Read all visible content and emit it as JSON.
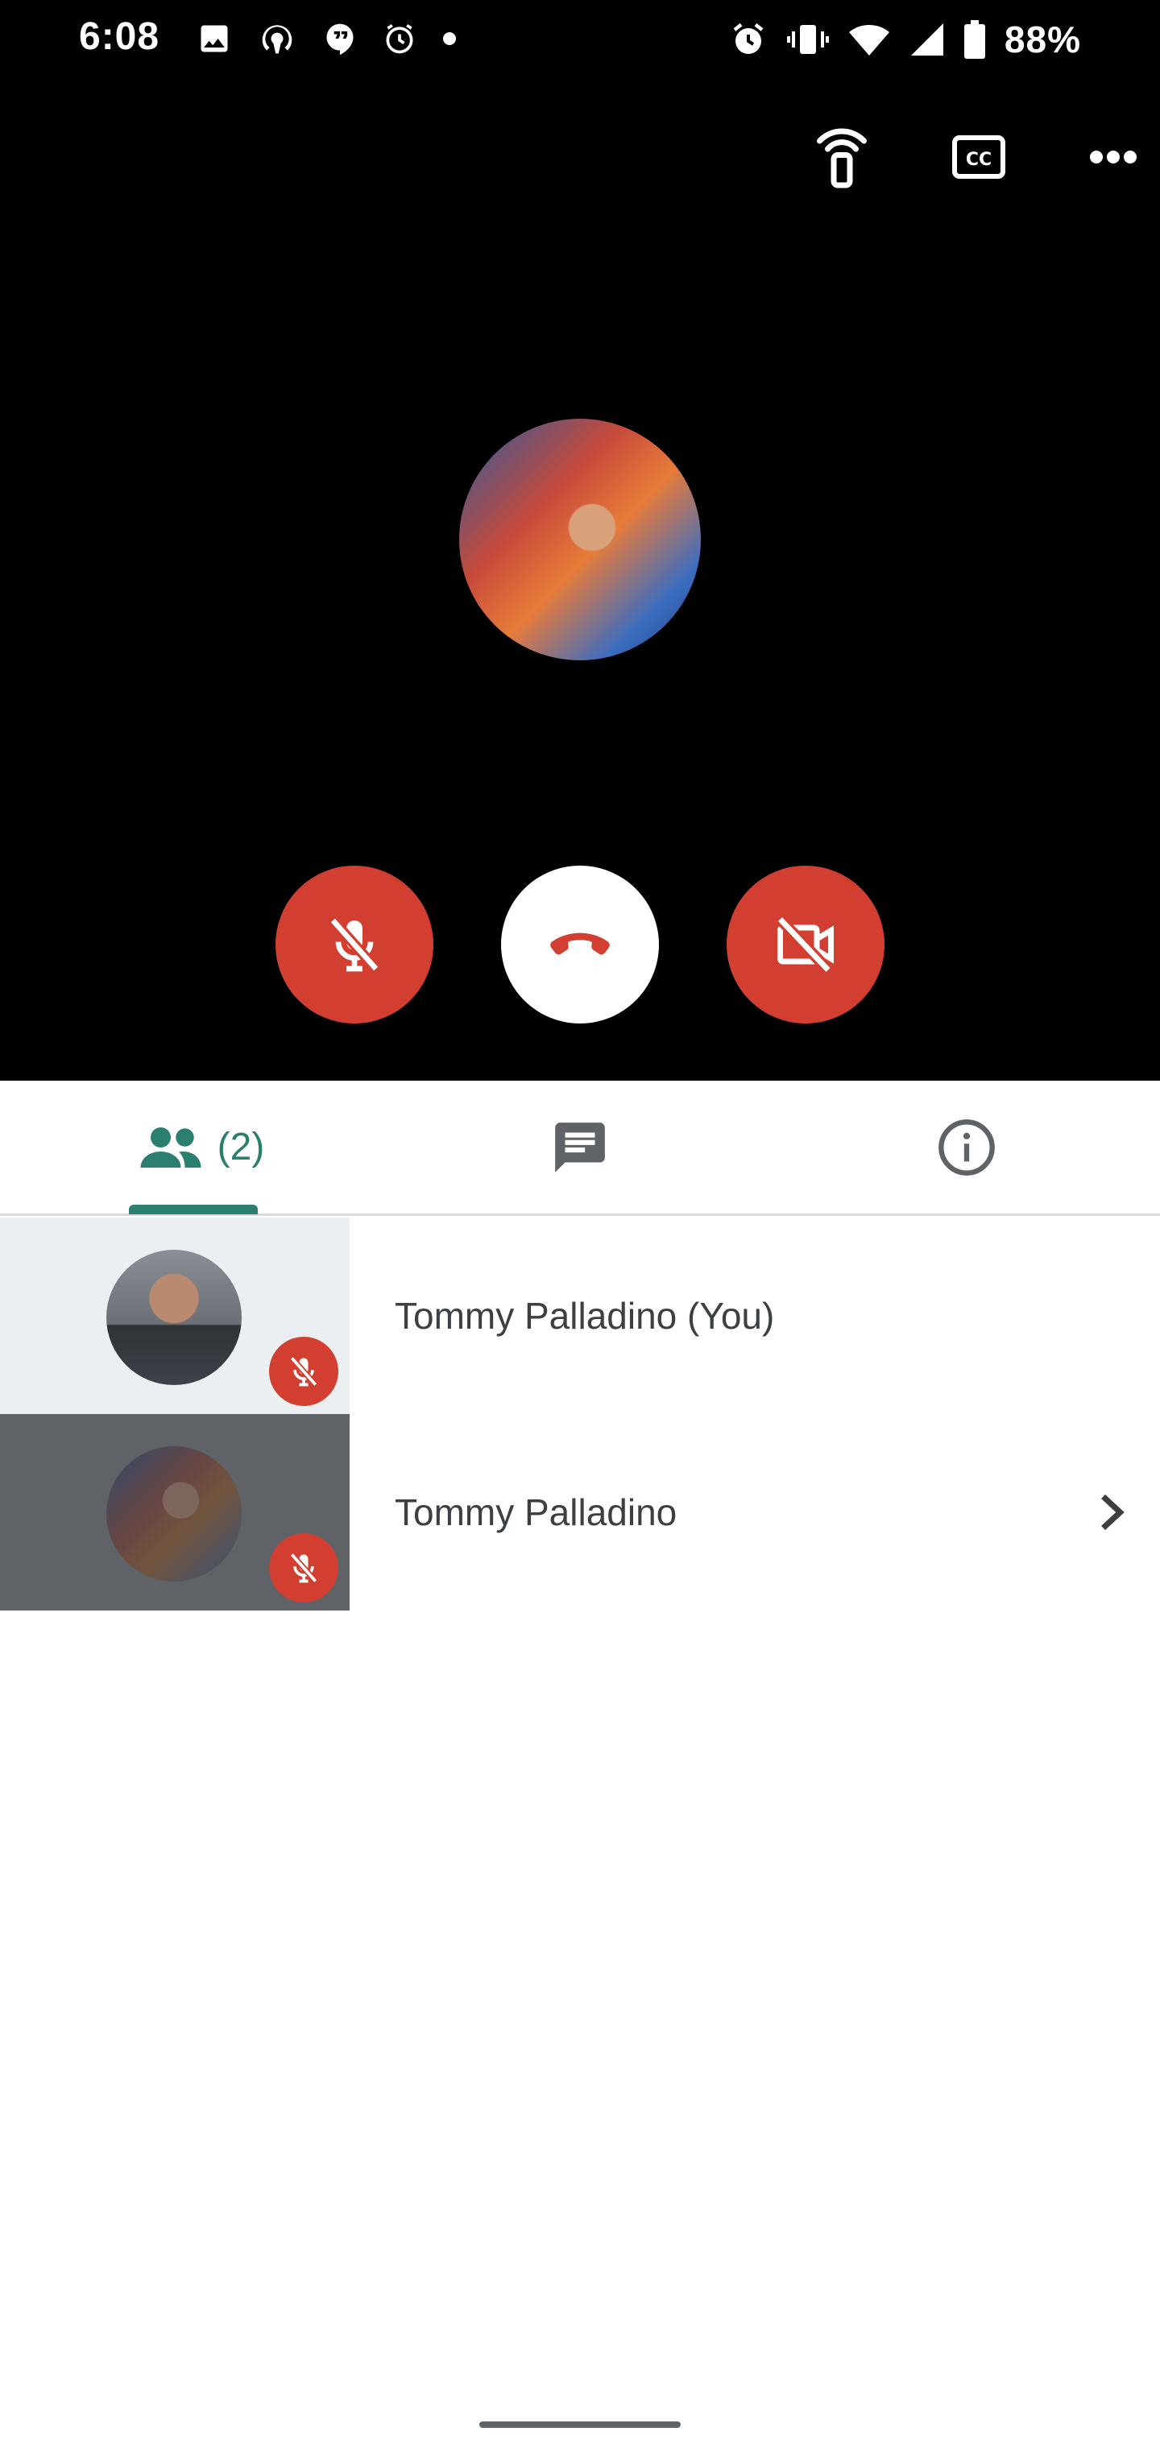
{
  "status_bar": {
    "time": "6:08",
    "battery": "88%",
    "left_icons": [
      "image-icon",
      "podcast-icon",
      "hangouts-icon",
      "clock-icon",
      "dot-icon"
    ],
    "right_icons": [
      "alarm-icon",
      "vibrate-icon",
      "wifi-icon",
      "signal-icon",
      "battery-icon"
    ]
  },
  "top_actions": [
    "cast-remote-icon",
    "closed-captions-icon",
    "more-options-icon"
  ],
  "call_controls": {
    "mic": {
      "state": "muted",
      "icon": "mic-off-icon",
      "color": "#d23f31"
    },
    "hangup": {
      "icon": "hang-up-icon",
      "color": "#ffffff",
      "icon_color": "#d23f31"
    },
    "camera": {
      "state": "off",
      "icon": "camera-off-icon",
      "color": "#d23f31"
    }
  },
  "tabs": {
    "people": {
      "icon": "people-icon",
      "count": "(2)",
      "selected": true
    },
    "chat": {
      "icon": "chat-icon"
    },
    "info": {
      "icon": "info-icon"
    },
    "accent_color": "#2a7f6f"
  },
  "participants": [
    {
      "name": "Tommy Palladino (You)",
      "muted": true,
      "has_chevron": false
    },
    {
      "name": "Tommy Palladino",
      "muted": true,
      "has_chevron": true
    }
  ]
}
